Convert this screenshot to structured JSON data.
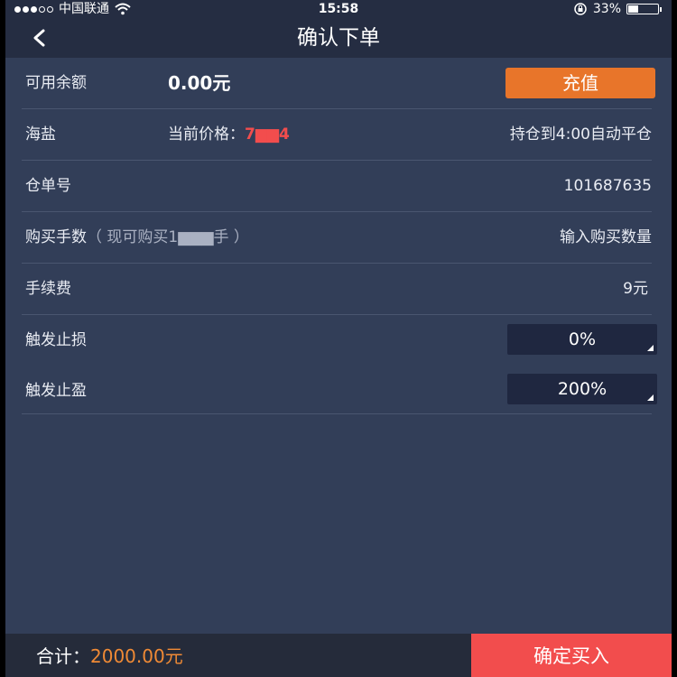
{
  "status_bar": {
    "carrier": "中国联通",
    "time": "15:58",
    "battery_percent": "33%",
    "battery_level": 0.33,
    "signal_icon": "signal-dots-icon",
    "wifi_icon": "wifi-icon",
    "lock_icon": "rotation-lock-icon"
  },
  "nav": {
    "title": "确认下单",
    "back_icon": "chevron-left-icon"
  },
  "balance": {
    "label": "可用余额",
    "value": "0.00元",
    "recharge_label": "充值"
  },
  "product": {
    "name": "海盐",
    "price_label": "当前价格：",
    "price_value": "7▆▆4",
    "hold_note": "持仓到4:00自动平仓"
  },
  "order_no": {
    "label": "仓单号",
    "value": "101687635"
  },
  "quantity": {
    "label": "购买手数",
    "hint": "（ 现可购买1▆▆▆手 ）",
    "placeholder": "输入购买数量"
  },
  "fee": {
    "label": "手续费",
    "value": "9元"
  },
  "stop_loss": {
    "label": "触发止损",
    "value": "0%"
  },
  "take_profit": {
    "label": "触发止盈",
    "value": "200%"
  },
  "footer": {
    "total_label": "合计：",
    "total_value": "2000.00元",
    "confirm_label": "确定买入"
  },
  "colors": {
    "background": "#323e58",
    "header": "#252d42",
    "accent_orange": "#e8752a",
    "price_red": "#f24d4d",
    "confirm_red": "#f24d4d",
    "total_orange": "#f08a35"
  }
}
